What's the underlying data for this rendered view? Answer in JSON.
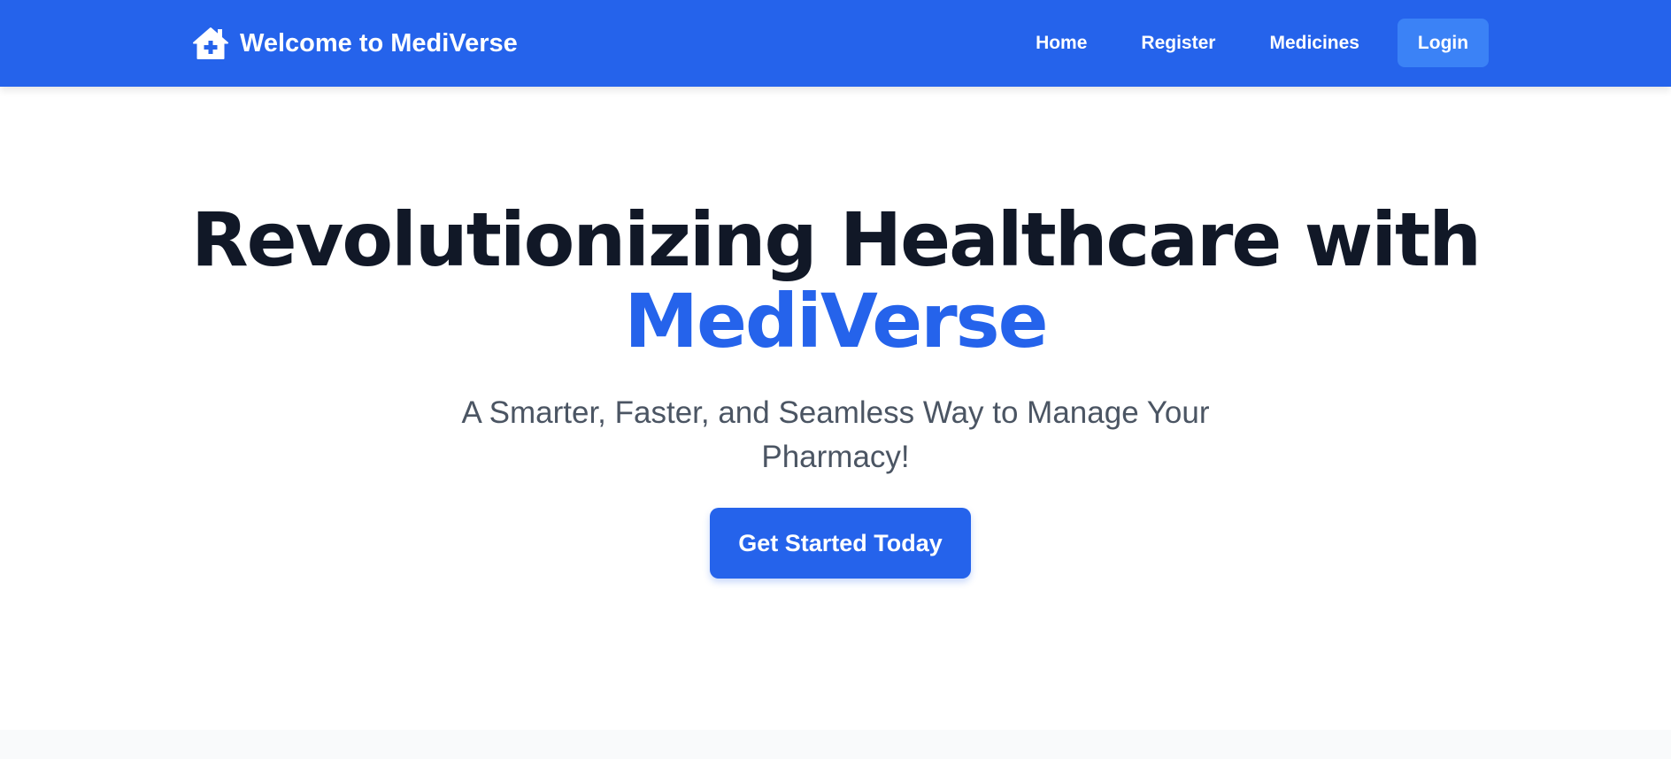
{
  "navbar": {
    "brand": "Welcome to MediVerse",
    "brand_icon": "home-medical-icon",
    "links": [
      "Home",
      "Register",
      "Medicines"
    ],
    "login_label": "Login"
  },
  "hero": {
    "headline_line1": "Revolutionizing Healthcare with",
    "headline_brand": "MediVerse",
    "subtitle": "A Smarter, Faster, and Seamless Way to Manage Your Pharmacy!",
    "cta_label": "Get Started Today"
  },
  "colors": {
    "primary": "#2563eb",
    "login_button": "#3b82f6",
    "heading": "#111827",
    "subtitle": "#4b5563",
    "page_background": "#ffffff",
    "next_section_background": "#f9fafb"
  }
}
